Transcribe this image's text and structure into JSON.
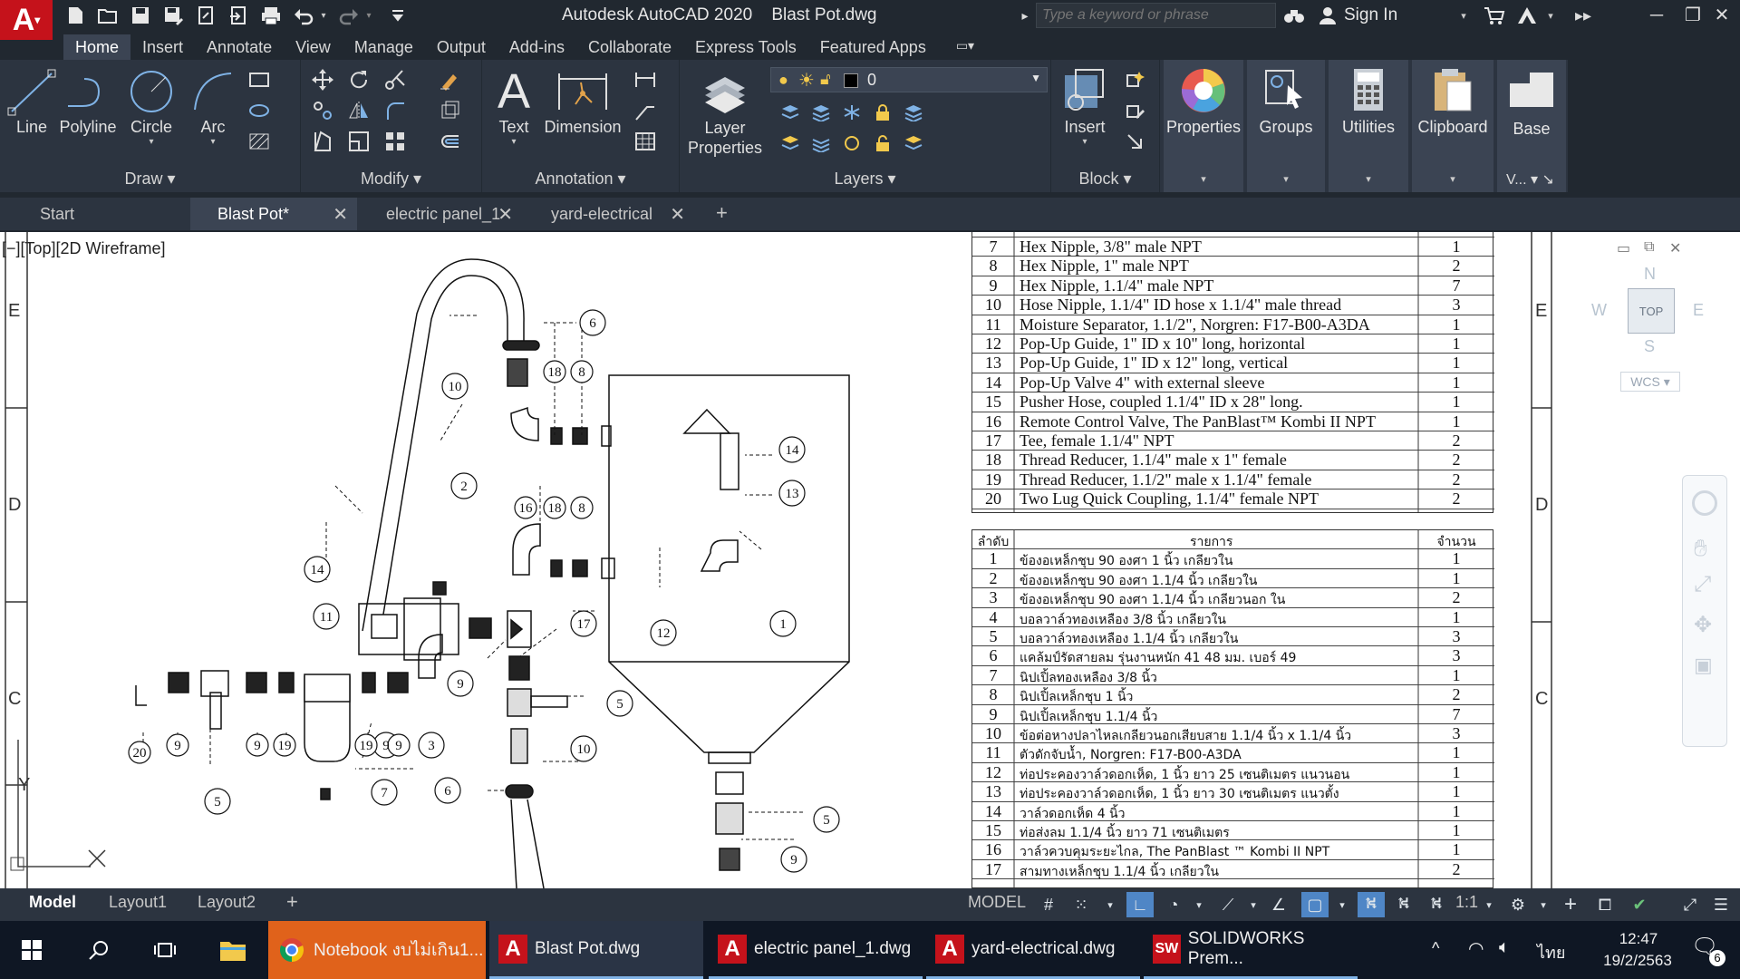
{
  "title": {
    "app": "Autodesk AutoCAD 2020",
    "file": "Blast Pot.dwg",
    "search_placeholder": "Type a keyword or phrase",
    "sign_in": "Sign In"
  },
  "ribbon_tabs": [
    "Home",
    "Insert",
    "Annotate",
    "View",
    "Manage",
    "Output",
    "Add-ins",
    "Collaborate",
    "Express Tools",
    "Featured Apps"
  ],
  "draw_panel": {
    "label": "Draw",
    "tools": [
      "Line",
      "Polyline",
      "Circle",
      "Arc"
    ]
  },
  "modify_panel": {
    "label": "Modify"
  },
  "annotation_panel": {
    "label": "Annotation",
    "tools": [
      "Text",
      "Dimension"
    ]
  },
  "layers_panel": {
    "label": "Layers",
    "layer_props_1": "Layer",
    "layer_props_2": "Properties",
    "current_layer": "0"
  },
  "block_panel": {
    "label": "Block",
    "insert": "Insert"
  },
  "right_tools": [
    "Properties",
    "Groups",
    "Utilities",
    "Clipboard",
    "Base"
  ],
  "view_label": "V...",
  "doc_tabs": [
    {
      "label": "Start"
    },
    {
      "label": "Blast Pot*"
    },
    {
      "label": "electric panel_1"
    },
    {
      "label": "yard-electrical"
    }
  ],
  "viewport_label": "[−][Top][2D Wireframe]",
  "border_letters": [
    "E",
    "D",
    "C"
  ],
  "viewcube": {
    "n": "N",
    "s": "S",
    "e": "E",
    "w": "W",
    "top": "TOP",
    "wcs": "WCS"
  },
  "parts_en": [
    {
      "n": "7",
      "d": "Hex Nipple, 3/8\" male NPT",
      "q": "1"
    },
    {
      "n": "8",
      "d": "Hex Nipple, 1\" male NPT",
      "q": "2"
    },
    {
      "n": "9",
      "d": "Hex Nipple, 1.1/4\" male NPT",
      "q": "7"
    },
    {
      "n": "10",
      "d": "Hose Nipple, 1.1/4\" ID hose x 1.1/4\" male thread",
      "q": "3"
    },
    {
      "n": "11",
      "d": "Moisture Separator, 1.1/2\", Norgren: F17-B00-A3DA",
      "q": "1"
    },
    {
      "n": "12",
      "d": "Pop-Up Guide, 1\" ID x 10\" long, horizontal",
      "q": "1"
    },
    {
      "n": "13",
      "d": "Pop-Up Guide, 1\" ID x 12\" long, vertical",
      "q": "1"
    },
    {
      "n": "14",
      "d": "Pop-Up Valve 4\" with external sleeve",
      "q": "1"
    },
    {
      "n": "15",
      "d": "Pusher Hose, coupled 1.1/4\" ID x 28\" long.",
      "q": "1"
    },
    {
      "n": "16",
      "d": "Remote Control Valve, The PanBlast™ Kombi II NPT",
      "q": "1"
    },
    {
      "n": "17",
      "d": "Tee, female 1.1/4\" NPT",
      "q": "2"
    },
    {
      "n": "18",
      "d": "Thread Reducer, 1.1/4\" male x 1\" female",
      "q": "2"
    },
    {
      "n": "19",
      "d": "Thread Reducer, 1.1/2\" male x 1.1/4\" female",
      "q": "2"
    },
    {
      "n": "20",
      "d": "Two Lug Quick Coupling, 1.1/4\" female NPT",
      "q": "2"
    }
  ],
  "parts_th_header": {
    "n": "ลำดับ",
    "d": "รายการ",
    "q": "จำนวน"
  },
  "parts_th": [
    {
      "n": "1",
      "d": "ข้องอเหล็กชุบ 90 องศา 1 นิ้ว เกลียวใน",
      "q": "1"
    },
    {
      "n": "2",
      "d": "ข้องอเหล็กชุบ 90 องศา 1.1/4 นิ้ว เกลียวใน",
      "q": "1"
    },
    {
      "n": "3",
      "d": "ข้องอเหล็กชุบ 90 องศา 1.1/4 นิ้ว เกลียวนอก ใน",
      "q": "2"
    },
    {
      "n": "4",
      "d": "บอลวาล์วทองเหลือง 3/8 นิ้ว เกลียวใน",
      "q": "1"
    },
    {
      "n": "5",
      "d": "บอลวาล์วทองเหลือง 1.1/4 นิ้ว เกลียวใน",
      "q": "3"
    },
    {
      "n": "6",
      "d": "แคล้มป์รัดสายลม รุ่นงานหนัก 41 48 มม. เบอร์ 49",
      "q": "3"
    },
    {
      "n": "7",
      "d": "นิปเปิ้ลทองเหลือง 3/8 นิ้ว",
      "q": "1"
    },
    {
      "n": "8",
      "d": "นิปเปิ้ลเหล็กชุบ 1 นิ้ว",
      "q": "2"
    },
    {
      "n": "9",
      "d": "นิปเปิ้ลเหล็กชุบ 1.1/4 นิ้ว",
      "q": "7"
    },
    {
      "n": "10",
      "d": "ข้อต่อหางปลาไหลเกลียวนอกเสียบสาย 1.1/4 นิ้ว x 1.1/4 นิ้ว",
      "q": "3"
    },
    {
      "n": "11",
      "d": "ตัวดักจับน้ำ, Norgren: F17-B00-A3DA",
      "q": "1"
    },
    {
      "n": "12",
      "d": "ท่อประคองวาล์วดอกเห็ด, 1 นิ้ว ยาว 25 เซนติเมตร แนวนอน",
      "q": "1"
    },
    {
      "n": "13",
      "d": "ท่อประคองวาล์วดอกเห็ด, 1 นิ้ว ยาว 30 เซนติเมตร แนวตั้ง",
      "q": "1"
    },
    {
      "n": "14",
      "d": "วาล์วดอกเห็ด 4 นิ้ว",
      "q": "1"
    },
    {
      "n": "15",
      "d": "ท่อส่งลม 1.1/4 นิ้ว ยาว 71 เซนติเมตร",
      "q": "1"
    },
    {
      "n": "16",
      "d": "วาล์วควบคุมระยะไกล, The PanBlast ™ Kombi II NPT",
      "q": "1"
    },
    {
      "n": "17",
      "d": "สามทางเหล็กชุบ 1.1/4 นิ้ว เกลียวใน",
      "q": "2"
    }
  ],
  "status": {
    "layouts": [
      "Model",
      "Layout1",
      "Layout2"
    ],
    "model": "MODEL",
    "scale": "1:1"
  },
  "taskbar": {
    "apps": [
      "Notebook งบไม่เกิน1...",
      "Blast Pot.dwg",
      "electric panel_1.dwg",
      "yard-electrical.dwg",
      "SOLIDWORKS Prem..."
    ],
    "lang": "ไทย",
    "time": "12:47",
    "date": "19/2/2563",
    "notifications": "6"
  }
}
